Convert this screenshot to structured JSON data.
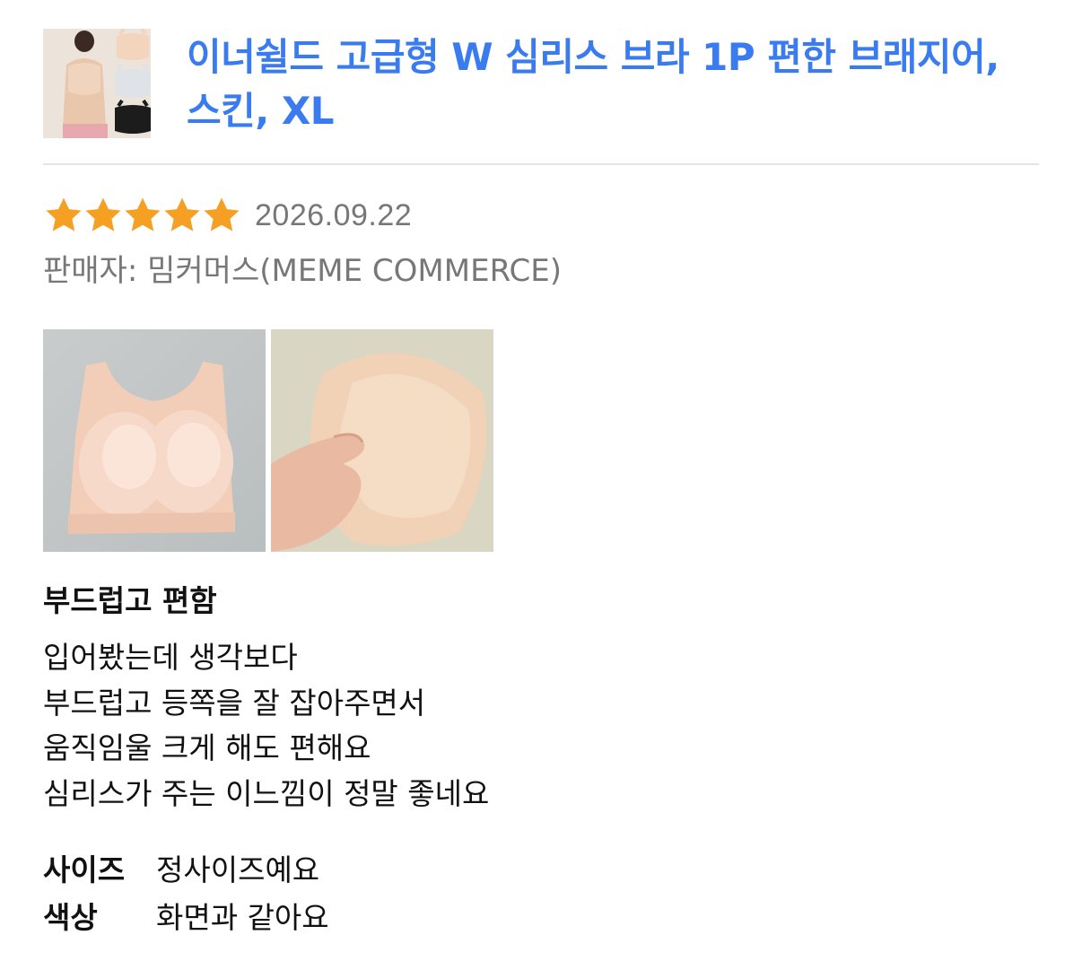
{
  "product": {
    "title": "이너쉴드 고급형 W 심리스 브라 1P 편한 브래지어, 스킨, XL",
    "thumbnail_icon": "product-thumbnail"
  },
  "review": {
    "rating": 5,
    "rating_max": 5,
    "star_color": "#f5a023",
    "date": "2026.09.22",
    "seller": "판매자: 밈커머스(MEME COMMERCE)",
    "heading": "부드럽고 편함",
    "body_lines": [
      "입어봤는데 생각보다",
      "부드럽고 등쪽을 잘 잡아주면서",
      "움직임울 크게 해도 편해요",
      "심리스가 주는 이느낌이 정말 좋네요"
    ],
    "attributes": [
      {
        "label": "사이즈",
        "value": "정사이즈예요"
      },
      {
        "label": "색상",
        "value": "화면과 같아요"
      }
    ]
  },
  "colors": {
    "title_link": "#3a7cf0",
    "muted_text": "#777777",
    "divider": "#e4e4e4"
  }
}
